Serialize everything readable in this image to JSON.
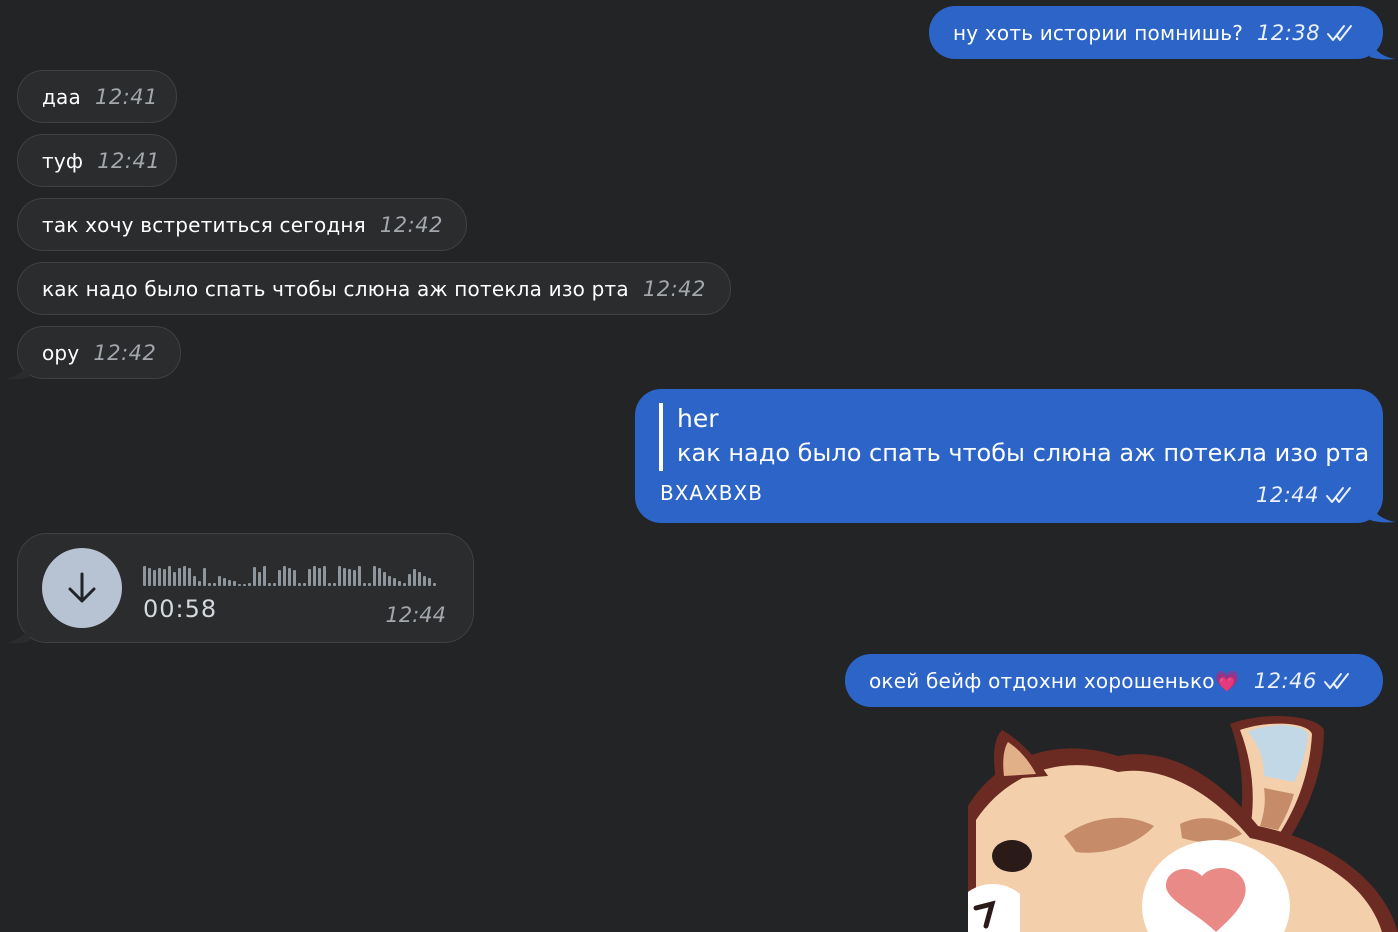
{
  "messages": {
    "m1": {
      "text": "ну хоть истории помнишь?",
      "time": "12:38"
    },
    "m2": {
      "text": "даа",
      "time": "12:41"
    },
    "m3": {
      "text": "туф",
      "time": "12:41"
    },
    "m4": {
      "text": "так хочу встретиться сегодня",
      "time": "12:42"
    },
    "m5": {
      "text": "как надо было спать чтобы слюна аж потекла изо рта",
      "time": "12:42"
    },
    "m6": {
      "text": "ору",
      "time": "12:42"
    },
    "reply": {
      "author": "her",
      "quoted": "как надо было спать чтобы слюна аж потекла изо рта",
      "text": "ВХАХВХВ",
      "time": "12:44"
    },
    "voice": {
      "duration": "00:58",
      "time": "12:44",
      "icon": "download-arrow-icon"
    },
    "m9": {
      "text": "окей бейф отдохни хорошенько",
      "emoji": "💗",
      "time": "12:46"
    }
  },
  "colors": {
    "background": "#222426",
    "incoming_bubble": "#2a2c2e",
    "outgoing_bubble": "#2c64c8"
  },
  "icons": {
    "read_receipt": "double-check-icon",
    "sticker": "cat-sticker-image"
  }
}
